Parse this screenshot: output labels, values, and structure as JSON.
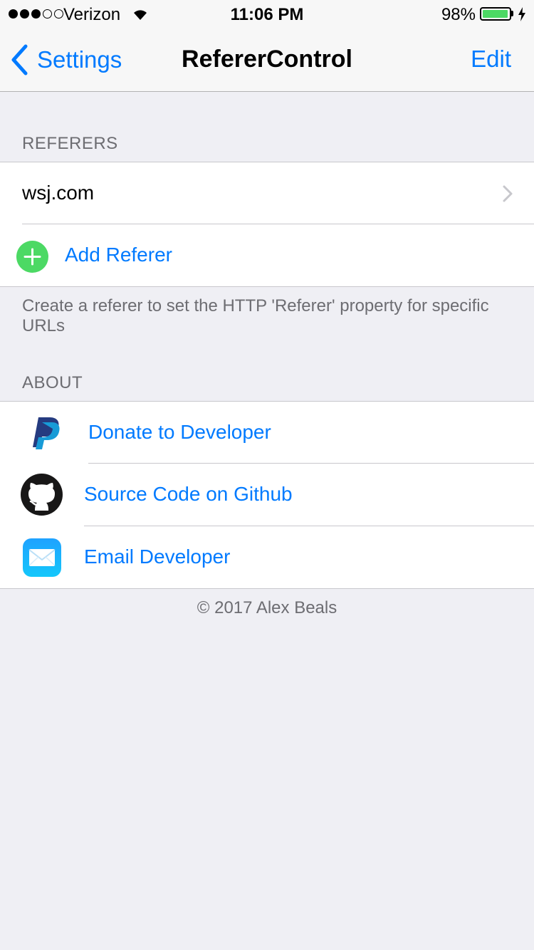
{
  "status_bar": {
    "carrier": "Verizon",
    "time": "11:06 PM",
    "battery_percent": "98%",
    "battery_level": 0.98,
    "signal_bars_filled": 3,
    "signal_bars_total": 5
  },
  "nav": {
    "back_label": "Settings",
    "title": "RefererControl",
    "edit_label": "Edit"
  },
  "referers": {
    "header": "REFERERS",
    "items": [
      {
        "label": "wsj.com"
      }
    ],
    "add_label": "Add Referer",
    "footer": "Create a referer to set the HTTP 'Referer' property for specific URLs"
  },
  "about": {
    "header": "ABOUT",
    "items": [
      {
        "label": "Donate to Developer",
        "icon": "paypal-icon"
      },
      {
        "label": "Source Code on Github",
        "icon": "github-icon"
      },
      {
        "label": "Email Developer",
        "icon": "mail-icon"
      }
    ],
    "copyright": "© 2017 Alex Beals"
  },
  "colors": {
    "accent": "#007aff",
    "add_green": "#4cd964",
    "background": "#efeff4"
  }
}
